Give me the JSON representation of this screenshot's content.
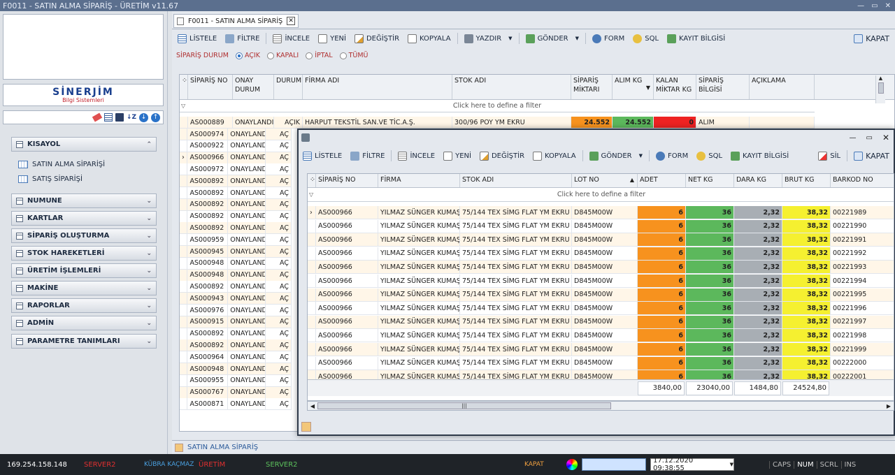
{
  "window": {
    "title": "F0011 - SATIN ALMA SİPARİŞ - ÜRETİM v11.67",
    "controls": [
      "—",
      "▭",
      "✕"
    ]
  },
  "left": {
    "logo_line1": "SİNERJİM",
    "logo_line2": "Bilgi Sistemleri",
    "menu": [
      {
        "label": "KISAYOL",
        "expanded": true
      },
      {
        "label": "NUMUNE"
      },
      {
        "label": "KARTLAR"
      },
      {
        "label": "SİPARİŞ OLUŞTURMA"
      },
      {
        "label": "STOK HAREKETLERİ"
      },
      {
        "label": "ÜRETİM İŞLEMLERİ"
      },
      {
        "label": "MAKİNE"
      },
      {
        "label": "RAPORLAR"
      },
      {
        "label": "ADMİN"
      },
      {
        "label": "PARAMETRE TANIMLARI"
      }
    ],
    "shortcuts": [
      "SATIN ALMA SİPARİŞİ",
      "SATIŞ SİPARİŞİ"
    ]
  },
  "tab": {
    "label": "F0011 - SATIN ALMA SİPARİŞ",
    "close": "✕"
  },
  "toolbar": {
    "listele": "LİSTELE",
    "filtre": "FİLTRE",
    "incele": "İNCELE",
    "yeni": "YENİ",
    "degistir": "DEĞİŞTİR",
    "kopyala": "KOPYALA",
    "yazdir": "YAZDIR",
    "gonder": "GÖNDER",
    "form": "FORM",
    "sql": "SQL",
    "kayit": "KAYIT BİLGİSİ",
    "kapat": "KAPAT"
  },
  "filter": {
    "label": "SİPARİŞ DURUM",
    "options": [
      "AÇIK",
      "KAPALI",
      "İPTAL",
      "TÜMÜ"
    ],
    "selected": "AÇIK"
  },
  "main_grid": {
    "headers": [
      "SİPARİŞ NO",
      "ONAY DURUM",
      "DURUM",
      "FİRMA ADI",
      "STOK ADI",
      "SİPARİŞ MİKTARI",
      "ALIM KG",
      "KALAN MİKTAR KG",
      "SİPARİŞ BİLGİSİ",
      "AÇIKLAMA"
    ],
    "filter_text": "Click here to define a filter",
    "first_row": {
      "no": "AS000889",
      "onay": "ONAYLANDI",
      "durum": "AÇIK",
      "firma": "HARPUT TEKSTİL SAN.VE TİC.A.Ş.",
      "stok": "300/96 POY YM EKRU",
      "siparis": "24.552",
      "alim": "24.552",
      "kalan": "0",
      "bilgi": "ALIM"
    },
    "rows": [
      {
        "no": "AS000974",
        "onay": "ONAYLANDI",
        "durum": "AÇ"
      },
      {
        "no": "AS000922",
        "onay": "ONAYLANDI",
        "durum": "AÇ"
      },
      {
        "no": "AS000966",
        "onay": "ONAYLANDI",
        "durum": "AÇ"
      },
      {
        "no": "AS000972",
        "onay": "ONAYLANDI",
        "durum": "AÇ"
      },
      {
        "no": "AS000892",
        "onay": "ONAYLANDI",
        "durum": "AÇ"
      },
      {
        "no": "AS000892",
        "onay": "ONAYLANDI",
        "durum": "AÇ"
      },
      {
        "no": "AS000892",
        "onay": "ONAYLANDI",
        "durum": "AÇ"
      },
      {
        "no": "AS000892",
        "onay": "ONAYLANDI",
        "durum": "AÇ"
      },
      {
        "no": "AS000892",
        "onay": "ONAYLANDI",
        "durum": "AÇ"
      },
      {
        "no": "AS000959",
        "onay": "ONAYLANDI",
        "durum": "AÇ"
      },
      {
        "no": "AS000945",
        "onay": "ONAYLANDI",
        "durum": "AÇ"
      },
      {
        "no": "AS000948",
        "onay": "ONAYLANDI",
        "durum": "AÇ"
      },
      {
        "no": "AS000948",
        "onay": "ONAYLANDI",
        "durum": "AÇ"
      },
      {
        "no": "AS000892",
        "onay": "ONAYLANDI",
        "durum": "AÇ"
      },
      {
        "no": "AS000943",
        "onay": "ONAYLANDI",
        "durum": "AÇ"
      },
      {
        "no": "AS000976",
        "onay": "ONAYLANDI",
        "durum": "AÇ"
      },
      {
        "no": "AS000915",
        "onay": "ONAYLANDI",
        "durum": "AÇ"
      },
      {
        "no": "AS000892",
        "onay": "ONAYLANDI",
        "durum": "AÇ"
      },
      {
        "no": "AS000892",
        "onay": "ONAYLANDI",
        "durum": "AÇ"
      },
      {
        "no": "AS000964",
        "onay": "ONAYLANDI",
        "durum": "AÇ"
      },
      {
        "no": "AS000948",
        "onay": "ONAYLANDI",
        "durum": "AÇ"
      },
      {
        "no": "AS000955",
        "onay": "ONAYLANDI",
        "durum": "AÇ"
      },
      {
        "no": "AS000767",
        "onay": "ONAYLANDI",
        "durum": "AÇ"
      },
      {
        "no": "AS000871",
        "onay": "ONAYLANDI",
        "durum": "AÇ"
      }
    ]
  },
  "bottom_tab": "SATIN ALMA SİPARİŞ",
  "detail": {
    "toolbar": {
      "listele": "LİSTELE",
      "filtre": "FİLTRE",
      "incele": "İNCELE",
      "yeni": "YENİ",
      "degistir": "DEĞİŞTİR",
      "kopyala": "KOPYALA",
      "gonder": "GÖNDER",
      "form": "FORM",
      "sql": "SQL",
      "kayit": "KAYIT BİLGİSİ",
      "sil": "SİL",
      "kapat": "KAPAT"
    },
    "headers": [
      "SİPARİŞ NO",
      "FİRMA",
      "STOK ADI",
      "LOT NO",
      "ADET",
      "NET KG",
      "DARA KG",
      "BRUT KG",
      "BARKOD NO"
    ],
    "filter_text": "Click here to define a filter",
    "rows": [
      {
        "no": "AS000966",
        "firma": "YILMAZ SÜNGER KUMAŞ D",
        "stok": "75/144 TEX SİMG FLAT YM EKRU",
        "lot": "D845M00W",
        "adet": "6",
        "net": "36",
        "dara": "2,32",
        "brut": "38,32",
        "barkod": "00221989"
      },
      {
        "no": "AS000966",
        "firma": "YILMAZ SÜNGER KUMAŞ D",
        "stok": "75/144 TEX SİMG FLAT YM EKRU",
        "lot": "D845M00W",
        "adet": "6",
        "net": "36",
        "dara": "2,32",
        "brut": "38,32",
        "barkod": "00221990"
      },
      {
        "no": "AS000966",
        "firma": "YILMAZ SÜNGER KUMAŞ D",
        "stok": "75/144 TEX SİMG FLAT YM EKRU",
        "lot": "D845M00W",
        "adet": "6",
        "net": "36",
        "dara": "2,32",
        "brut": "38,32",
        "barkod": "00221991"
      },
      {
        "no": "AS000966",
        "firma": "YILMAZ SÜNGER KUMAŞ D",
        "stok": "75/144 TEX SİMG FLAT YM EKRU",
        "lot": "D845M00W",
        "adet": "6",
        "net": "36",
        "dara": "2,32",
        "brut": "38,32",
        "barkod": "00221992"
      },
      {
        "no": "AS000966",
        "firma": "YILMAZ SÜNGER KUMAŞ D",
        "stok": "75/144 TEX SİMG FLAT YM EKRU",
        "lot": "D845M00W",
        "adet": "6",
        "net": "36",
        "dara": "2,32",
        "brut": "38,32",
        "barkod": "00221993"
      },
      {
        "no": "AS000966",
        "firma": "YILMAZ SÜNGER KUMAŞ D",
        "stok": "75/144 TEX SİMG FLAT YM EKRU",
        "lot": "D845M00W",
        "adet": "6",
        "net": "36",
        "dara": "2,32",
        "brut": "38,32",
        "barkod": "00221994"
      },
      {
        "no": "AS000966",
        "firma": "YILMAZ SÜNGER KUMAŞ D",
        "stok": "75/144 TEX SİMG FLAT YM EKRU",
        "lot": "D845M00W",
        "adet": "6",
        "net": "36",
        "dara": "2,32",
        "brut": "38,32",
        "barkod": "00221995"
      },
      {
        "no": "AS000966",
        "firma": "YILMAZ SÜNGER KUMAŞ D",
        "stok": "75/144 TEX SİMG FLAT YM EKRU",
        "lot": "D845M00W",
        "adet": "6",
        "net": "36",
        "dara": "2,32",
        "brut": "38,32",
        "barkod": "00221996"
      },
      {
        "no": "AS000966",
        "firma": "YILMAZ SÜNGER KUMAŞ D",
        "stok": "75/144 TEX SİMG FLAT YM EKRU",
        "lot": "D845M00W",
        "adet": "6",
        "net": "36",
        "dara": "2,32",
        "brut": "38,32",
        "barkod": "00221997"
      },
      {
        "no": "AS000966",
        "firma": "YILMAZ SÜNGER KUMAŞ D",
        "stok": "75/144 TEX SİMG FLAT YM EKRU",
        "lot": "D845M00W",
        "adet": "6",
        "net": "36",
        "dara": "2,32",
        "brut": "38,32",
        "barkod": "00221998"
      },
      {
        "no": "AS000966",
        "firma": "YILMAZ SÜNGER KUMAŞ D",
        "stok": "75/144 TEX SİMG FLAT YM EKRU",
        "lot": "D845M00W",
        "adet": "6",
        "net": "36",
        "dara": "2,32",
        "brut": "38,32",
        "barkod": "00221999"
      },
      {
        "no": "AS000966",
        "firma": "YILMAZ SÜNGER KUMAŞ D",
        "stok": "75/144 TEX SİMG FLAT YM EKRU",
        "lot": "D845M00W",
        "adet": "6",
        "net": "36",
        "dara": "2,32",
        "brut": "38,32",
        "barkod": "00222000"
      },
      {
        "no": "AS000966",
        "firma": "YILMAZ SÜNGER KUMAŞ D",
        "stok": "75/144 TEX SİMG FLAT YM EKRU",
        "lot": "D845M00W",
        "adet": "6",
        "net": "36",
        "dara": "2,32",
        "brut": "38,32",
        "barkod": "00222001"
      }
    ],
    "totals": {
      "adet": "3840,00",
      "net": "23040,00",
      "dara": "1484,80",
      "brut": "24524,80"
    }
  },
  "status": {
    "ip": "169.254.158.148",
    "server": "SERVER2",
    "user": "KÜBRA KAÇMAZ",
    "module": "ÜRETİM",
    "db": "SERVER2",
    "kapat": "KAPAT",
    "datetime": "17.12.2020 09:38:55",
    "caps": "CAPS",
    "num": "NUM",
    "scrl": "SCRL",
    "ins": "INS"
  },
  "colors": {
    "orange": "#f7921e",
    "green": "#5cb85c",
    "red": "#ee2222",
    "gray": "#a8aeb4",
    "yellow": "#f5f030"
  }
}
